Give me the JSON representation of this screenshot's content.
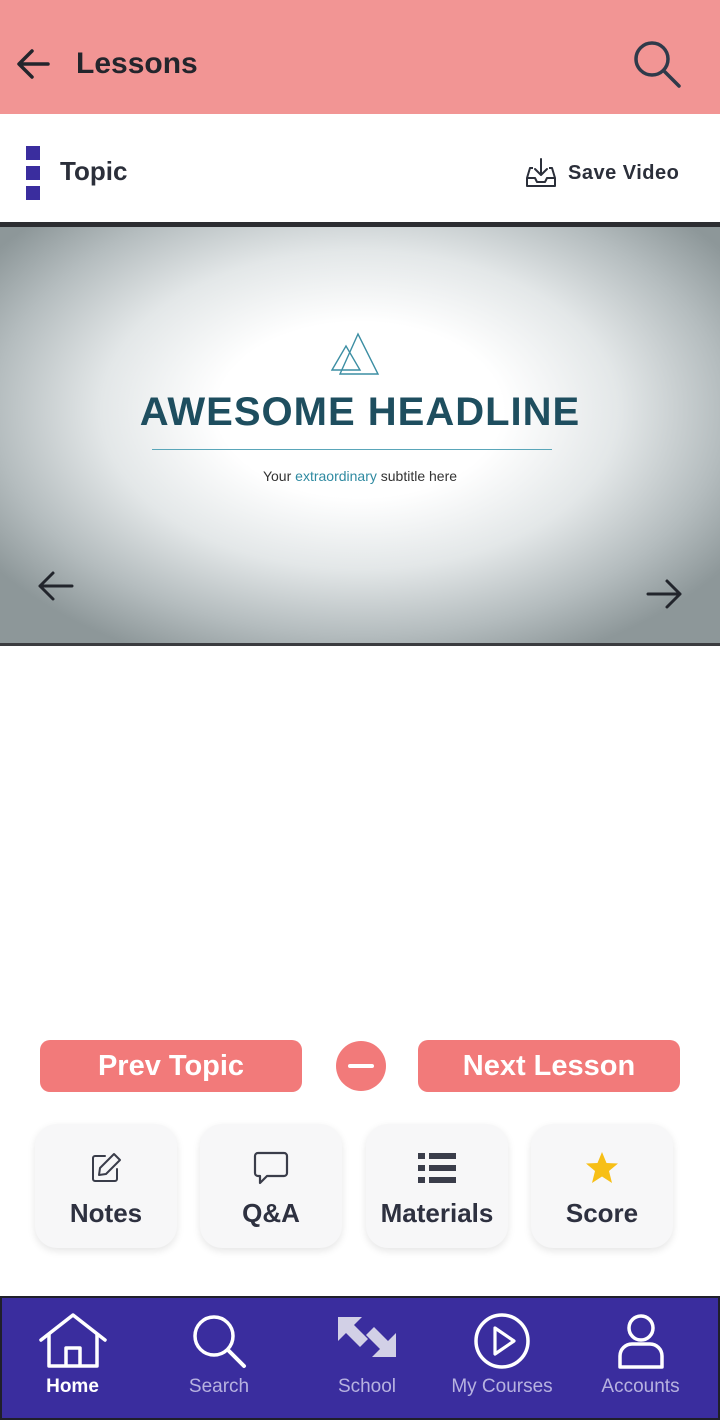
{
  "header": {
    "title": "Lessons"
  },
  "topic_bar": {
    "title": "Topic",
    "save_video_label": "Save Video"
  },
  "slide": {
    "headline": "AWESOME HEADLINE",
    "subtitle_before": "Your ",
    "subtitle_accent": "extraordinary",
    "subtitle_after": " subtitle here"
  },
  "lesson_nav": {
    "prev_label": "Prev Topic",
    "next_label": "Next Lesson"
  },
  "actions": [
    {
      "label": "Notes",
      "icon": "edit-note-icon"
    },
    {
      "label": "Q&A",
      "icon": "chat-bubble-icon"
    },
    {
      "label": "Materials",
      "icon": "list-icon"
    },
    {
      "label": "Score",
      "icon": "star-icon"
    }
  ],
  "bottom_nav": [
    {
      "label": "Home",
      "icon": "home-icon",
      "active": true
    },
    {
      "label": "Search",
      "icon": "search-icon"
    },
    {
      "label": "School",
      "icon": "school-icon"
    },
    {
      "label": "My Courses",
      "icon": "play-circle-icon"
    },
    {
      "label": "Accounts",
      "icon": "user-icon"
    }
  ],
  "colors": {
    "header_bg": "#f29594",
    "accent_button": "#f27a7a",
    "nav_bg": "#3a2d9e",
    "headline": "#1e4e5f",
    "star": "#f7bf16"
  }
}
